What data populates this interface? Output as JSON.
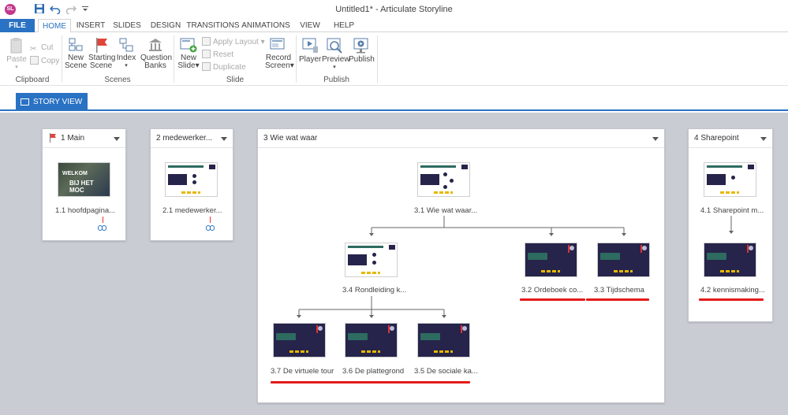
{
  "window": {
    "title": "Untitled1* - Articulate Storyline"
  },
  "app_icon_label": "SL",
  "ribbon_tabs": [
    "FILE",
    "HOME",
    "INSERT",
    "SLIDES",
    "DESIGN",
    "TRANSITIONS",
    "ANIMATIONS",
    "VIEW",
    "HELP"
  ],
  "ribbon": {
    "clipboard": {
      "paste": "Paste",
      "cut": "Cut",
      "copy": "Copy",
      "label": "Clipboard"
    },
    "scenes": {
      "new_scene_1": "New",
      "new_scene_2": "Scene",
      "starting_1": "Starting",
      "starting_2": "Scene",
      "index": "Index",
      "question_1": "Question",
      "question_2": "Banks",
      "label": "Scenes"
    },
    "slide": {
      "new_1": "New",
      "new_2": "Slide",
      "apply_layout": "Apply Layout",
      "reset": "Reset",
      "duplicate": "Duplicate",
      "record_1": "Record",
      "record_2": "Screen",
      "label": "Slide"
    },
    "publish": {
      "player": "Player",
      "preview": "Preview",
      "publish": "Publish",
      "label": "Publish"
    }
  },
  "view_tab": "STORY VIEW",
  "scenes": [
    {
      "title": "1 Main",
      "slides": [
        "1.1 hoofdpagina..."
      ]
    },
    {
      "title": "2  medewerker...",
      "slides": [
        "2.1 medewerker..."
      ]
    },
    {
      "title": "3 Wie wat waar",
      "slides": [
        "3.1 Wie wat waar...",
        "3.4 Rondleiding k...",
        "3.2 Ordeboek co...",
        "3.3 Tijdschema",
        "3.7 De virtuele tour",
        "3.6 De plattegrond",
        "3.5 De sociale ka..."
      ]
    },
    {
      "title": "4 Sharepoint",
      "slides": [
        "4.1 Sharepoint m...",
        "4.2 kennismaking..."
      ]
    }
  ],
  "thumb_text": {
    "welkom": "WELKOM",
    "bij_het_moc": "BIJ HET MOC"
  },
  "colors": {
    "accent": "#2a72c3",
    "canvas": "#c9ccd3",
    "annotation": "#e41a1a"
  }
}
